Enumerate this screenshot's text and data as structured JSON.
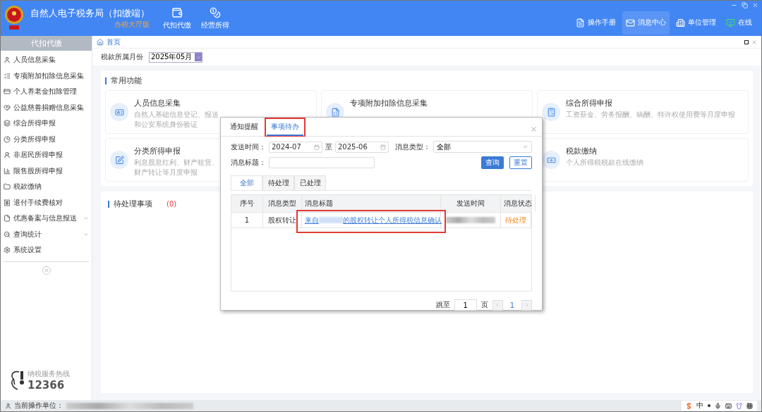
{
  "header": {
    "title": "自然人电子税务局（扣缴端）",
    "subtitle": "办税大厅版",
    "nav": [
      {
        "label": "代扣代缴"
      },
      {
        "label": "经营所得"
      }
    ],
    "tools": [
      {
        "label": "操作手册",
        "selected": false
      },
      {
        "label": "消息中心",
        "selected": true
      },
      {
        "label": "单位管理",
        "selected": false
      },
      {
        "label": "在线",
        "selected": false
      }
    ]
  },
  "sidebar": {
    "title": "代扣代缴",
    "items": [
      {
        "label": "人员信息采集",
        "expandable": false
      },
      {
        "label": "专项附加扣除信息采集",
        "expandable": false
      },
      {
        "label": "个人养老金扣除管理",
        "expandable": false
      },
      {
        "label": "公益慈善捐赠信息采集",
        "expandable": false
      },
      {
        "label": "综合所得申报",
        "expandable": false
      },
      {
        "label": "分类所得申报",
        "expandable": false
      },
      {
        "label": "非居民所得申报",
        "expandable": false
      },
      {
        "label": "限售股所得申报",
        "expandable": false
      },
      {
        "label": "税款缴纳",
        "expandable": false
      },
      {
        "label": "退付手续费核对",
        "expandable": false
      },
      {
        "label": "优惠备案与信息报送",
        "expandable": true
      },
      {
        "label": "查询统计",
        "expandable": true
      },
      {
        "label": "系统设置",
        "expandable": false
      }
    ],
    "hotline_label": "纳税服务热线",
    "hotline_number": "12366"
  },
  "breadcrumb": "首页",
  "month_filter": {
    "label": "税款所属月份",
    "value": "2025年05月"
  },
  "common_functions": {
    "title": "常用功能",
    "cards": [
      {
        "kind": "function",
        "title": "人员信息采集",
        "description": "自然人基础信息登记、报送和公安系统身份验证"
      },
      {
        "kind": "function",
        "title": "专项附加扣除信息采集"
      },
      {
        "kind": "function",
        "title": "综合所得申报",
        "description": "工资薪金、劳务报酬、稿酬、特许权使用费等月度申报"
      },
      {
        "kind": "function",
        "title": "分类所得申报",
        "description": "利息股息红利、财产租赁、财产转让等月度申报"
      },
      {
        "kind": "hidden"
      },
      {
        "kind": "function",
        "title": "税款缴纳",
        "description": "个人所得税税款在线缴纳"
      }
    ]
  },
  "pending": {
    "title": "待处理事项",
    "count": "(0)"
  },
  "dialog": {
    "tabs": [
      {
        "label": "通知提醒",
        "selected": false
      },
      {
        "label": "事项待办",
        "selected": true
      }
    ],
    "send_time_label": "发送时间：",
    "from": "2024-07",
    "to_label": "至",
    "to": "2025-06",
    "type_label": "消息类型：",
    "type_value": "全部",
    "title_label": "消息标题：",
    "search_button": "查询",
    "reset_button": "重置",
    "filter_tabs": [
      {
        "label": "全部",
        "selected": true
      },
      {
        "label": "待处理",
        "selected": false
      },
      {
        "label": "已处理",
        "selected": false
      }
    ],
    "columns": [
      "序号",
      "消息类型",
      "消息标题",
      "发送时间",
      "消息状态"
    ],
    "rows": [
      {
        "index": "1",
        "type": "股权转让",
        "title_prefix": "来自",
        "title_suffix": "的股权转让个人所得税信息确认",
        "status": "待处理"
      }
    ],
    "jump_label": "跳至",
    "jump_value": "1",
    "page_label": "页",
    "page": "1"
  },
  "status_bar": {
    "label": "当前操作单位：",
    "ime": "中"
  }
}
